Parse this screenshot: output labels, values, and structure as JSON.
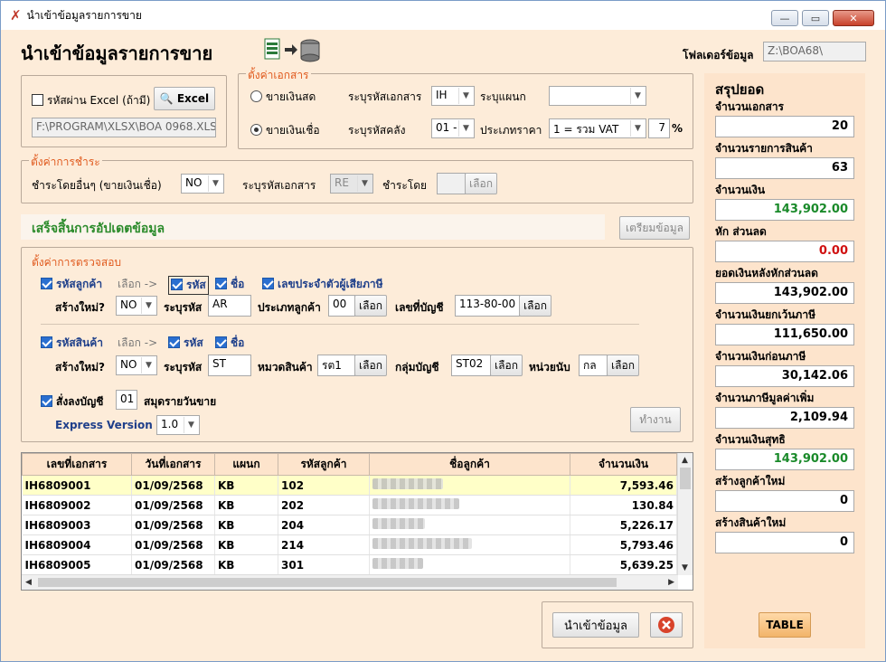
{
  "window": {
    "title": "นำเข้าข้อมูลรายการขาย"
  },
  "header": {
    "title": "นำเข้าข้อมูลรายการขาย",
    "folder_label": "โฟลเดอร์ข้อมูล",
    "folder_value": "Z:\\BOA68\\"
  },
  "excel": {
    "password_label": "รหัสผ่าน Excel (ถ้ามี)",
    "excel_button": "Excel",
    "path": "F:\\PROGRAM\\XLSX\\BOA 0968.XLSX"
  },
  "doc_settings": {
    "title": "ตั้งค่าเอกสาร",
    "cash_label": "ขายเงินสด",
    "credit_label": "ขายเงินเชื่อ",
    "doc_code_label": "ระบุรหัสเอกสาร",
    "doc_code_value": "IH",
    "dept_label": "ระบุแผนก",
    "dept_value": "",
    "warehouse_label": "ระบุรหัสคลัง",
    "warehouse_value": "01 -",
    "price_type_label": "ประเภทราคา",
    "price_type_value": "1 = รวม VAT",
    "vat_value": "7",
    "vat_unit": "%"
  },
  "payment": {
    "title": "ตั้งค่าการชำระ",
    "other_label": "ชำระโดยอื่นๆ (ขายเงินเชื่อ)",
    "other_value": "NO",
    "doc_code_label": "ระบุรหัสเอกสาร",
    "doc_code_value": "RE",
    "pay_by_label": "ชำระโดย",
    "pay_by_value": "",
    "select_button": "เลือก"
  },
  "status": {
    "message": "เสร็จสิ้นการอัปเดตข้อมูล",
    "prepare_button": "เตรียมข้อมูล"
  },
  "verify": {
    "title": "ตั้งค่าการตรวจสอบ",
    "customer": {
      "code_label": "รหัสลูกค้า",
      "choose_label": "เลือก ->",
      "code_chk": "รหัส",
      "name_chk": "ชื่อ",
      "tax_chk": "เลขประจำตัวผู้เสียภาษี",
      "create_label": "สร้างใหม่?",
      "create_value": "NO",
      "code_spec_label": "ระบุรหัส",
      "code_spec_value": "AR",
      "type_label": "ประเภทลูกค้า",
      "type_value": "00",
      "account_label": "เลขที่บัญชี",
      "account_value": "113-80-00"
    },
    "product": {
      "code_label": "รหัสสินค้า",
      "choose_label": "เลือก ->",
      "code_chk": "รหัส",
      "name_chk": "ชื่อ",
      "create_label": "สร้างใหม่?",
      "create_value": "NO",
      "code_spec_label": "ระบุรหัส",
      "code_spec_value": "ST",
      "category_label": "หมวดสินค้า",
      "category_value": "รต1",
      "group_label": "กลุ่มบัญชี",
      "group_value": "ST02",
      "unit_label": "หน่วยนับ",
      "unit_value": "กล"
    },
    "journal_label": "สั่งลงบัญชี",
    "journal_value": "01",
    "journal_name": "สมุดรายวันขาย",
    "express_label": "Express Version",
    "express_value": "1.0",
    "run_button": "ทำงาน",
    "select_button": "เลือก"
  },
  "table": {
    "columns": [
      "เลขที่เอกสาร",
      "วันที่เอกสาร",
      "แผนก",
      "รหัสลูกค้า",
      "ชื่อลูกค้า",
      "จำนวนเงิน"
    ],
    "rows": [
      {
        "doc": "IH6809001",
        "date": "01/09/2568",
        "dept": "KB",
        "cust": "102",
        "amount": "7,593.46"
      },
      {
        "doc": "IH6809002",
        "date": "01/09/2568",
        "dept": "KB",
        "cust": "202",
        "amount": "130.84"
      },
      {
        "doc": "IH6809003",
        "date": "01/09/2568",
        "dept": "KB",
        "cust": "204",
        "amount": "5,226.17"
      },
      {
        "doc": "IH6809004",
        "date": "01/09/2568",
        "dept": "KB",
        "cust": "214",
        "amount": "5,793.46"
      },
      {
        "doc": "IH6809005",
        "date": "01/09/2568",
        "dept": "KB",
        "cust": "301",
        "amount": "5,639.25"
      }
    ]
  },
  "bottom": {
    "import_button": "นำเข้าข้อมูล"
  },
  "summary": {
    "title": "สรุปยอด",
    "items": [
      {
        "label": "จำนวนเอกสาร",
        "value": "20",
        "color": "#000000"
      },
      {
        "label": "จำนวนรายการสินค้า",
        "value": "63",
        "color": "#000000"
      },
      {
        "label": "จำนวนเงิน",
        "value": "143,902.00",
        "color": "#1a8a2a"
      },
      {
        "label": "หัก ส่วนลด",
        "value": "0.00",
        "color": "#d01010"
      },
      {
        "label": "ยอดเงินหลังหักส่วนลด",
        "value": "143,902.00",
        "color": "#000000"
      },
      {
        "label": "จำนวนเงินยกเว้นภาษี",
        "value": "111,650.00",
        "color": "#000000"
      },
      {
        "label": "จำนวนเงินก่อนภาษี",
        "value": "30,142.06",
        "color": "#000000"
      },
      {
        "label": "จำนวนภาษีมูลค่าเพิ่ม",
        "value": "2,109.94",
        "color": "#000000"
      },
      {
        "label": "จำนวนเงินสุทธิ",
        "value": "143,902.00",
        "color": "#1a8a2a"
      },
      {
        "label": "สร้างลูกค้าใหม่",
        "value": "0",
        "color": "#000000"
      },
      {
        "label": "สร้างสินค้าใหม่",
        "value": "0",
        "color": "#000000"
      }
    ],
    "table_button": "TABLE"
  }
}
